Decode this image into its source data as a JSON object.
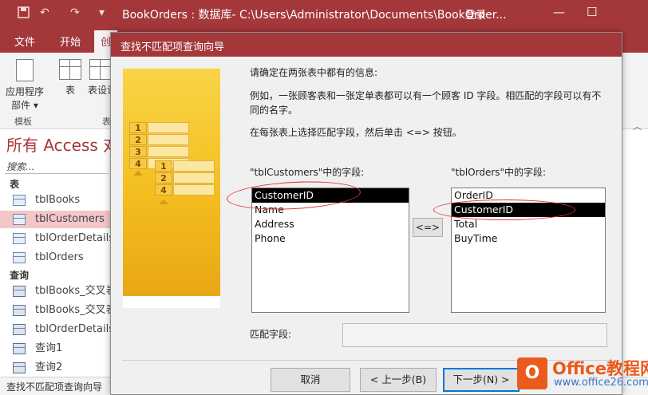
{
  "titlebar": {
    "doc_title": "BookOrders : 数据库- C:\\Users\\Administrator\\Documents\\BookOrder...",
    "login": "登录",
    "save_icon": "save-icon",
    "undo_glyph": "↶",
    "redo_glyph": "↷",
    "customize_glyph": "▾",
    "help_glyph": "?",
    "restore_glyph": "❐",
    "minimize_glyph": "—",
    "maximize_glyph": "☐"
  },
  "ribbon_tabs": [
    {
      "label": "文件"
    },
    {
      "label": "开始"
    },
    {
      "label": "创"
    }
  ],
  "ribbon": {
    "app_parts_line1": "应用程序",
    "app_parts_line2": "部件 ▾",
    "table": "表",
    "table_design": "表设计",
    "group_templates": "模板",
    "group_tables": "表"
  },
  "nav": {
    "title": "所有 Access 对",
    "search_placeholder": "搜索...",
    "tables_header": "表",
    "tables": [
      {
        "label": "tblBooks"
      },
      {
        "label": "tblCustomers"
      },
      {
        "label": "tblOrderDetails"
      },
      {
        "label": "tblOrders"
      }
    ],
    "queries_header": "查询",
    "queries": [
      {
        "label": "tblBooks_交叉表"
      },
      {
        "label": "tblBooks_交叉表"
      },
      {
        "label": "tblOrderDetails_交"
      },
      {
        "label": "查询1"
      },
      {
        "label": "查询2"
      }
    ]
  },
  "status_bar": {
    "text": "查找不匹配项查询向导"
  },
  "dialog": {
    "title": "查找不匹配项查询向导",
    "instruction": "请确定在两张表中都有的信息:",
    "example_line1": "例如，一张顾客表和一张定单表都可以有一个顾客 ID 字段。相匹配的字段可以有不",
    "example_line2": "同的名字。",
    "select_hint": "在每张表上选择匹配字段，然后单击 <=> 按钮。",
    "left_label": "\"tblCustomers\"中的字段:",
    "right_label": "\"tblOrders\"中的字段:",
    "left_fields": [
      "CustomerID",
      "Name",
      "Address",
      "Phone"
    ],
    "right_fields": [
      "OrderID",
      "CustomerID",
      "Total",
      "BuyTime"
    ],
    "match_button": "<=>",
    "matched_label": "匹配字段:",
    "matched_value": "",
    "buttons": {
      "cancel": "取消",
      "back": "< 上一步(B)",
      "next": "下一步(N) >"
    },
    "illustration_numbers_a": [
      "1",
      "2",
      "3",
      "4"
    ],
    "illustration_numbers_b": [
      "1",
      "2",
      "4"
    ]
  },
  "watermark": {
    "logo_glyph": "O",
    "line1": "Office教程网",
    "line2": "www.office26.com"
  },
  "colors": {
    "accent": "#a4373a",
    "selected_nav": "#f4c6c7",
    "highlight_circle": "#e0343a",
    "list_selection": "#000000"
  }
}
